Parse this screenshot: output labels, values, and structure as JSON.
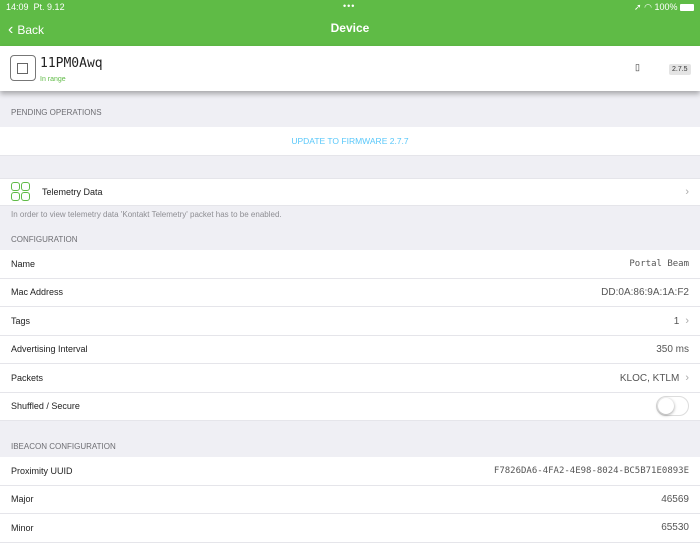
{
  "status_bar": {
    "time": "14:09",
    "date": "Pt. 9.12",
    "battery": "100%"
  },
  "nav": {
    "back_label": "Back",
    "title": "Device"
  },
  "device": {
    "name": "11PM0Awq",
    "state": "In range",
    "battery_icon": "battery-icon",
    "firmware": "2.7.5"
  },
  "pending": {
    "header": "PENDING OPERATIONS",
    "action": "UPDATE TO FIRMWARE 2.7.7"
  },
  "telemetry": {
    "label": "Telemetry Data",
    "note": "In order to view telemetry data 'Kontakt Telemetry' packet has to be enabled."
  },
  "configuration": {
    "header": "CONFIGURATION",
    "rows": [
      {
        "label": "Name",
        "value": "Portal Beam"
      },
      {
        "label": "Mac Address",
        "value": "DD:0A:86:9A:1A:F2"
      },
      {
        "label": "Tags",
        "value": "1"
      },
      {
        "label": "Advertising Interval",
        "value": "350 ms"
      },
      {
        "label": "Packets",
        "value": "KLOC, KTLM"
      },
      {
        "label": "Shuffled / Secure",
        "value": false
      }
    ]
  },
  "ibeacon": {
    "header": "IBEACON CONFIGURATION",
    "rows": [
      {
        "label": "Proximity UUID",
        "value": "F7826DA6-4FA2-4E98-8024-BC5B71E0893E"
      },
      {
        "label": "Major",
        "value": "46569"
      },
      {
        "label": "Minor",
        "value": "65530"
      }
    ]
  }
}
